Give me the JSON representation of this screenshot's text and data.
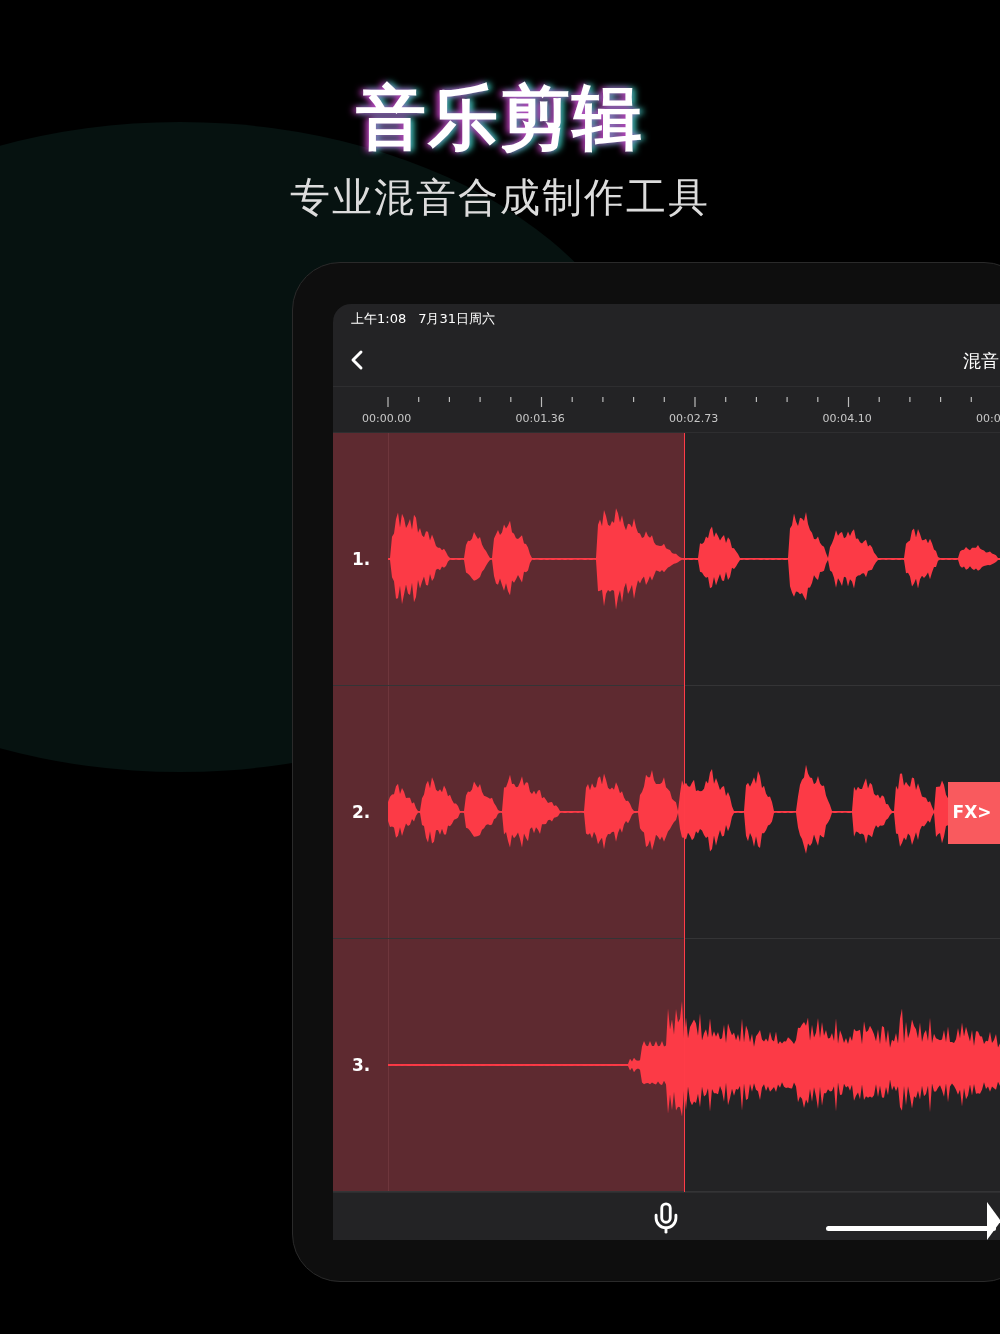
{
  "heading": {
    "title": "音乐剪辑",
    "subtitle": "专业混音合成制作工具"
  },
  "status_bar": {
    "time": "上午1:08",
    "date": "7月31日周六"
  },
  "nav": {
    "title": "混音"
  },
  "ruler": {
    "labels": [
      "00:00.00",
      "00:01.36",
      "00:02.73",
      "00:04.10",
      "00:0"
    ]
  },
  "tracks": [
    {
      "label": "1."
    },
    {
      "label": "2.",
      "fx_button": "FX>"
    },
    {
      "label": "3."
    }
  ]
}
